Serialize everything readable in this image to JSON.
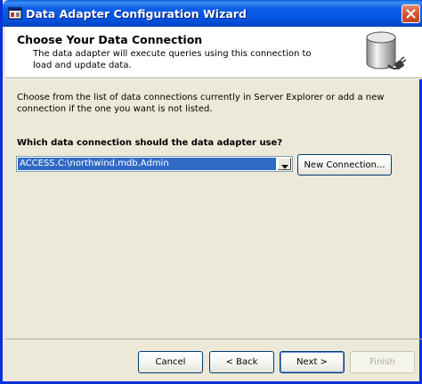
{
  "window": {
    "title": "Data Adapter Configuration Wizard"
  },
  "header": {
    "title": "Choose Your Data Connection",
    "description": "The data adapter will execute queries using this connection to load and update data.",
    "icon": "database-plug-icon"
  },
  "body": {
    "intro": "Choose from the list of data connections currently in Server Explorer or add a new connection if the one you want is not listed.",
    "question": "Which data connection should the data adapter use?",
    "connection_value": "ACCESS.C:\\northwind.mdb.Admin",
    "new_connection_label": "New Connection..."
  },
  "footer": {
    "cancel_label": "Cancel",
    "back_label": "< Back",
    "next_label": "Next >",
    "finish_label": "Finish"
  },
  "colors": {
    "titlebar": "#0355e3",
    "selection": "#316ac5",
    "dialog_bg": "#ece9d8"
  }
}
